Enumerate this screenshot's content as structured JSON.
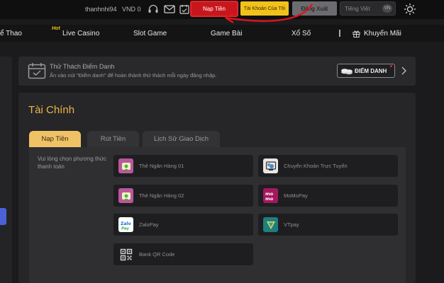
{
  "topbar": {
    "username": "thanhnhi94",
    "balance": "VND 0",
    "deposit_label": "Nạp Tiền",
    "account_label": "Tài Khoản Của Tôi",
    "logout_label": "Đăng Xuất",
    "language": "Tiếng Việt",
    "language_flag": "VN",
    "icons": [
      "headset-icon",
      "mail-icon",
      "calendar-check-icon",
      "sun-icon"
    ]
  },
  "nav": {
    "items": [
      {
        "label": "ể Thao"
      },
      {
        "label": "Live Casino",
        "badge": "Hot"
      },
      {
        "label": "Slot Game"
      },
      {
        "label": "Game Bài"
      },
      {
        "label": "Xổ Số"
      },
      {
        "label": "Khuyến Mãi"
      }
    ]
  },
  "challenge": {
    "title": "Thử Thách Điểm Danh",
    "subtitle": "Ấn vào nút \"Điểm danh\" để hoàn thành thử thách mỗi ngày đăng nhập.",
    "button_label": "ĐIỂM DANH"
  },
  "finance": {
    "title": "Tài Chính",
    "tabs": [
      {
        "label": "Nạp Tiền",
        "active": true
      },
      {
        "label": "Rút Tiền",
        "active": false
      },
      {
        "label": "Lịch Sử Giao Dịch",
        "active": false
      }
    ],
    "hint": "Vui lòng chọn phương thức thanh toán",
    "methods": [
      {
        "label": "Thẻ Ngân Hàng 01",
        "icon": "card-icon"
      },
      {
        "label": "Chuyển Khoản Trực Tuyến",
        "icon": "online-transfer-icon"
      },
      {
        "label": "Thẻ Ngân Hàng 02",
        "icon": "card-icon"
      },
      {
        "label": "MoMoPay",
        "icon": "momo-icon"
      },
      {
        "label": "ZaloPay",
        "icon": "zalopay-icon"
      },
      {
        "label": "VTpay",
        "icon": "vtpay-icon"
      },
      {
        "label": "Bank QR Code",
        "icon": "qr-code-icon"
      }
    ]
  },
  "colors": {
    "accent_gold": "#e8b64a",
    "deposit_red": "#c8161d",
    "account_yellow": "#f2c21a"
  }
}
